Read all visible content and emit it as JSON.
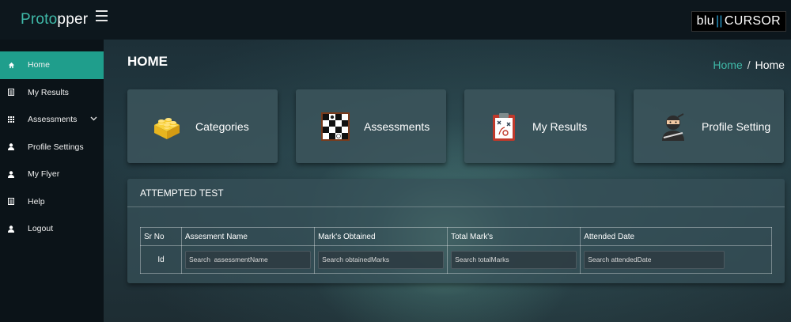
{
  "brand": {
    "part1": "Proto",
    "part2": "pper"
  },
  "logo": {
    "left": "blu",
    "sep": "||",
    "right": "CURSOR"
  },
  "sidebar": {
    "items": [
      {
        "label": "Home",
        "icon": "home-icon",
        "active": true
      },
      {
        "label": "My Results",
        "icon": "list-icon"
      },
      {
        "label": "Assessments",
        "icon": "grid-icon",
        "has_chevron": true
      },
      {
        "label": "Profile Settings",
        "icon": "user-icon"
      },
      {
        "label": "My Flyer",
        "icon": "user-icon"
      },
      {
        "label": "Help",
        "icon": "list-icon"
      },
      {
        "label": "Logout",
        "icon": "user-icon"
      }
    ]
  },
  "header": {
    "title": "HOME",
    "breadcrumb": {
      "link": "Home",
      "separator": "/",
      "current": "Home"
    }
  },
  "cards": [
    {
      "label": "Categories",
      "icon": "lego-brick-icon"
    },
    {
      "label": "Assessments",
      "icon": "checkerboard-icon"
    },
    {
      "label": "My Results",
      "icon": "clipboard-strategy-icon"
    },
    {
      "label": "Profile Setting",
      "icon": "ninja-icon"
    }
  ],
  "attempted": {
    "title": "ATTEMPTED TEST",
    "columns": [
      "Sr No",
      "Assesment Name",
      "Mark's Obtained",
      "Total Mark's",
      "Attended Date"
    ],
    "filter_row": {
      "id_label": "Id",
      "placeholders": [
        "Search  assessmentName",
        "Search obtainedMarks",
        "Search totalMarks",
        "Search attendedDate"
      ]
    }
  },
  "colors": {
    "accent": "#1f9e8c",
    "brand_teal": "#3fb9a8",
    "sidebar_bg": "#0b1318",
    "topbar_bg": "#0d171d"
  }
}
